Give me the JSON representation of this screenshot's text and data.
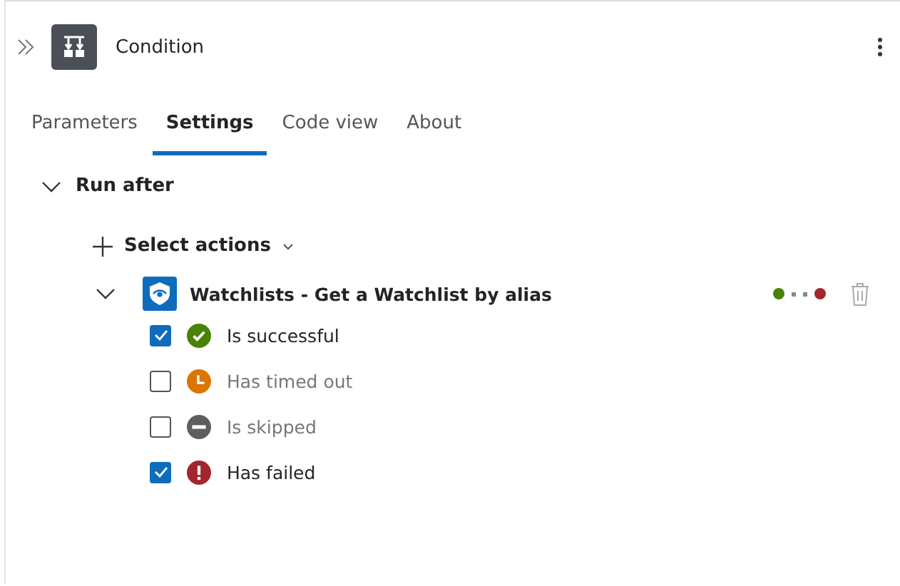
{
  "header": {
    "title": "Condition"
  },
  "tabs": [
    {
      "label": "Parameters",
      "selected": false
    },
    {
      "label": "Settings",
      "selected": true
    },
    {
      "label": "Code view",
      "selected": false
    },
    {
      "label": "About",
      "selected": false
    }
  ],
  "section": {
    "title": "Run after",
    "expanded": true
  },
  "select_actions": {
    "label": "Select actions"
  },
  "action": {
    "title": "Watchlists - Get a Watchlist by alias",
    "expanded": true,
    "statuses": [
      {
        "kind": "success",
        "label": "Is successful",
        "checked": true,
        "color": "#498205"
      },
      {
        "kind": "timeout",
        "label": "Has timed out",
        "checked": false,
        "color": "#db7500"
      },
      {
        "kind": "skipped",
        "label": "Is skipped",
        "checked": false,
        "color": "#605e5c"
      },
      {
        "kind": "failed",
        "label": "Has failed",
        "checked": true,
        "color": "#a4262c"
      }
    ]
  }
}
